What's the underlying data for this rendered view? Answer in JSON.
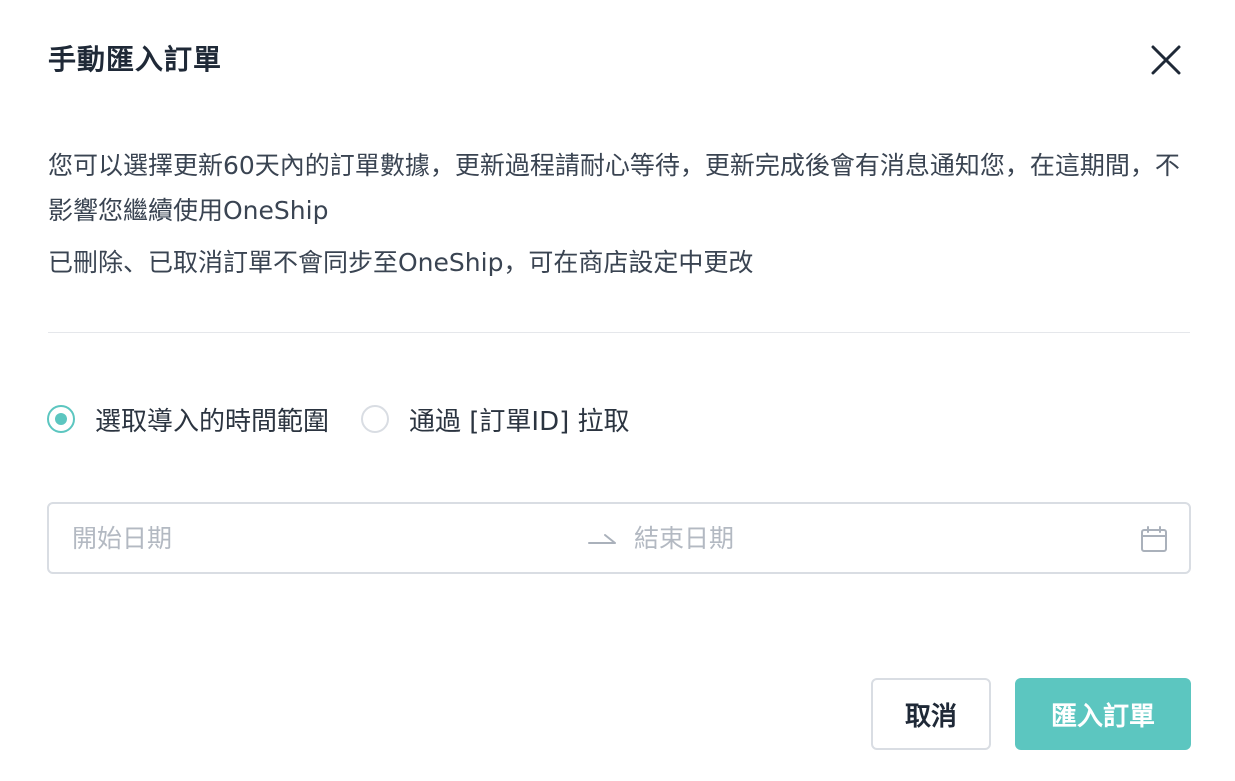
{
  "dialog": {
    "title": "手動匯入訂單",
    "close_icon": "close-icon"
  },
  "description": {
    "line1": "您可以選擇更新60天內的訂單數據，更新過程請耐心等待，更新完成後會有消息通知您，在這期間，不影響您繼續使用OneShip",
    "line2": "已刪除、已取消訂單不會同步至OneShip，可在商店設定中更改"
  },
  "import_mode": {
    "options": [
      {
        "label": "選取導入的時間範圍",
        "checked": true
      },
      {
        "label": "通過 [訂單ID] 拉取",
        "checked": false
      }
    ]
  },
  "date_range": {
    "start_placeholder": "開始日期",
    "end_placeholder": "結束日期",
    "separator_icon": "arrow-right-icon",
    "calendar_icon": "calendar-icon"
  },
  "footer": {
    "cancel_label": "取消",
    "submit_label": "匯入訂單"
  },
  "colors": {
    "accent": "#5cc6c0",
    "border": "#d9dde3",
    "text": "#2b3440",
    "placeholder": "#b3b9c2"
  }
}
